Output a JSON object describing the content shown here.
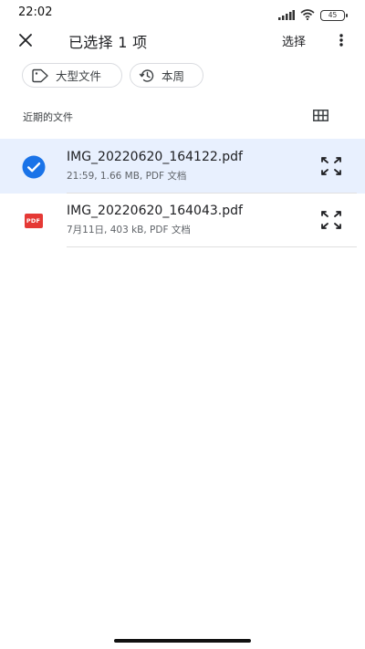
{
  "status_bar": {
    "time": "22:02",
    "battery": "45",
    "icons": [
      "signal-icon",
      "wifi-icon",
      "battery-icon"
    ]
  },
  "app_bar": {
    "title": "已选择 1 项",
    "select_label": "选择",
    "icons": [
      "close-icon",
      "more-vert-icon"
    ]
  },
  "filters": [
    {
      "label": "大型文件",
      "icon": "tag-icon"
    },
    {
      "label": "本周",
      "icon": "history-icon"
    }
  ],
  "section": {
    "label": "近期的文件",
    "view_icon": "grid-view-icon"
  },
  "files": [
    {
      "name": "IMG_20220620_164122.pdf",
      "meta": "21:59, 1.66 MB, PDF 文档",
      "selected": true,
      "icon": "check-circle-icon"
    },
    {
      "name": "IMG_20220620_164043.pdf",
      "meta": "7月11日, 403 kB, PDF 文档",
      "selected": false,
      "icon": "pdf-icon",
      "icon_text": "PDF"
    }
  ],
  "colors": {
    "selected_row_bg": "#e8f0fe",
    "accent_blue": "#1a73e8",
    "pdf_red": "#e53935"
  }
}
